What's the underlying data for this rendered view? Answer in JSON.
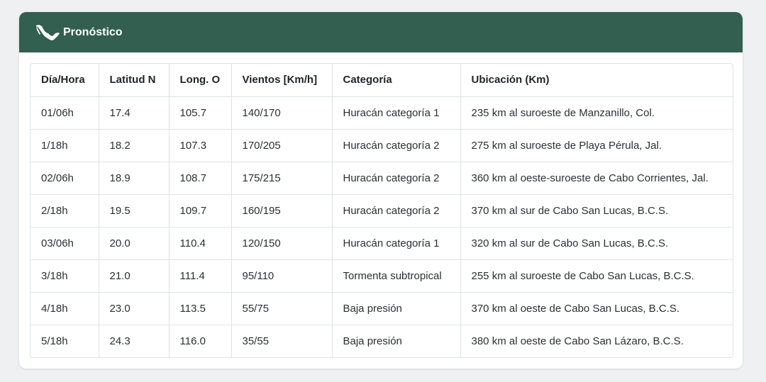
{
  "header": {
    "title": "Pronóstico",
    "icon": "mexico-map-icon",
    "background": "#325f4f"
  },
  "table": {
    "headers": [
      "Día/Hora",
      "Latitud N",
      "Long. O",
      "Vientos [Km/h]",
      "Categoría",
      "Ubicación (Km)"
    ],
    "rows": [
      [
        "01/06h",
        "17.4",
        "105.7",
        "140/170",
        "Huracán categoría 1",
        "235 km al suroeste de Manzanillo, Col."
      ],
      [
        "1/18h",
        "18.2",
        "107.3",
        "170/205",
        "Huracán categoría 2",
        "275 km al suroeste de Playa Pérula, Jal."
      ],
      [
        "02/06h",
        "18.9",
        "108.7",
        "175/215",
        "Huracán categoría 2",
        "360 km al oeste-suroeste de Cabo Corrientes, Jal."
      ],
      [
        "2/18h",
        "19.5",
        "109.7",
        "160/195",
        "Huracán categoría 2",
        "370 km al sur de Cabo San Lucas, B.C.S."
      ],
      [
        "03/06h",
        "20.0",
        "110.4",
        "120/150",
        "Huracán categoría 1",
        "320 km al sur de Cabo San Lucas, B.C.S."
      ],
      [
        "3/18h",
        "21.0",
        "111.4",
        "95/110",
        "Tormenta subtropical",
        "255 km al suroeste de Cabo San Lucas, B.C.S."
      ],
      [
        "4/18h",
        "23.0",
        "113.5",
        "55/75",
        "Baja presión",
        "370 km al oeste de Cabo San Lucas, B.C.S."
      ],
      [
        "5/18h",
        "24.3",
        "116.0",
        "35/55",
        "Baja presión",
        "380 km al oeste de Cabo San Lázaro, B.C.S."
      ]
    ]
  }
}
